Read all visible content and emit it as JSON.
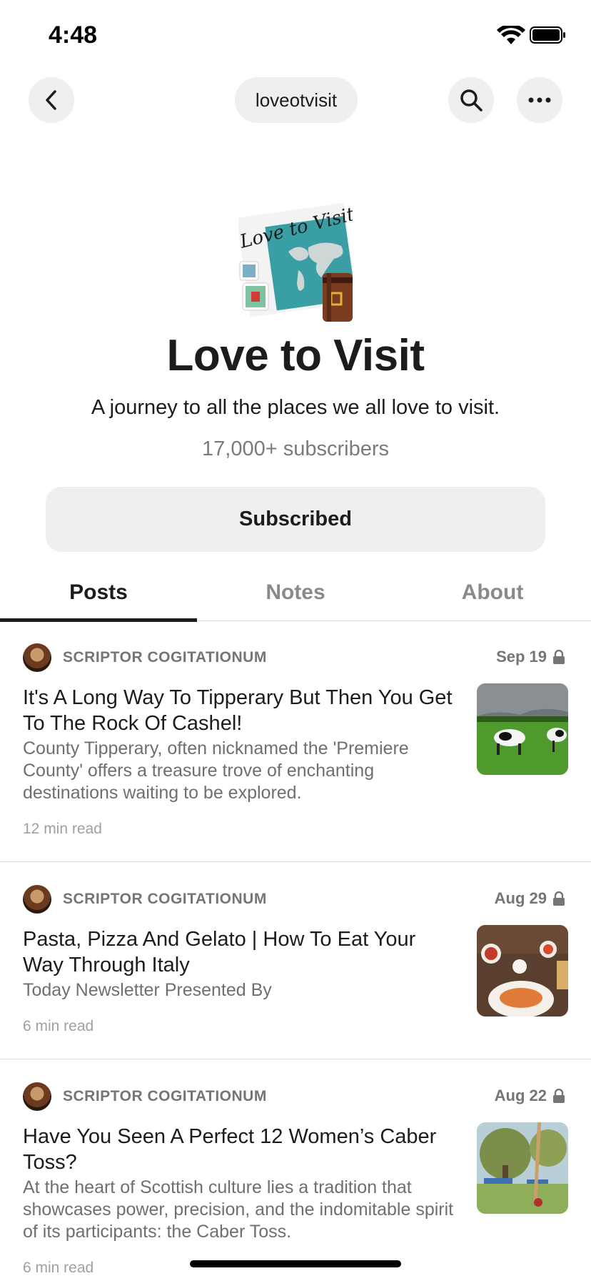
{
  "status_bar": {
    "time": "4:48"
  },
  "nav": {
    "handle": "loveotvisit",
    "back_icon": "chevron-left-icon",
    "search_icon": "search-icon",
    "more_icon": "ellipsis-icon"
  },
  "publication": {
    "title": "Love to Visit",
    "description": "A journey to all the places we all love to visit.",
    "subscribers": "17,000+ subscribers",
    "subscribe_label": "Subscribed",
    "logo_text": "Love to Visit"
  },
  "tabs": [
    {
      "label": "Posts",
      "active": true
    },
    {
      "label": "Notes",
      "active": false
    },
    {
      "label": "About",
      "active": false
    }
  ],
  "posts": [
    {
      "author": "SCRIPTOR COGITATIONUM",
      "date": "Sep 19",
      "locked": true,
      "title": "It's A Long Way To Tipperary But Then You Get To The Rock Of Cashel!",
      "excerpt": "County Tipperary, often nicknamed the 'Premiere County' offers a treasure trove of enchanting destinations waiting to be explored.",
      "read_time": "12 min read"
    },
    {
      "author": "SCRIPTOR COGITATIONUM",
      "date": "Aug 29",
      "locked": true,
      "title": "Pasta, Pizza And Gelato | How To Eat Your Way Through Italy",
      "excerpt": "Today Newsletter Presented By",
      "read_time": "6 min read"
    },
    {
      "author": "SCRIPTOR COGITATIONUM",
      "date": "Aug 22",
      "locked": true,
      "title": "Have You Seen A Perfect 12 Women’s Caber Toss?",
      "excerpt": "At the heart of Scottish culture lies a tradition that showcases power, precision, and the indomitable spirit of its participants: the Caber Toss.",
      "read_time": "6 min read"
    }
  ]
}
